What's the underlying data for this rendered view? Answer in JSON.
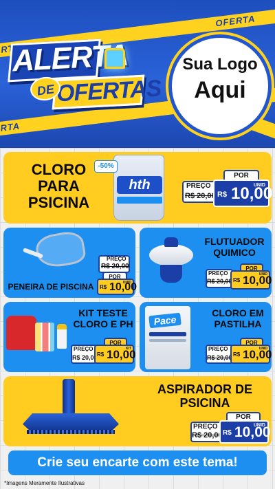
{
  "header": {
    "alerta": "ALERTA",
    "de": "DE",
    "ofertas": "OFERTAS",
    "stripe_text": "OFERTA",
    "stripe_text_2": "ALERTA",
    "logo_line1": "Sua Logo",
    "logo_line2": "Aqui"
  },
  "products": [
    {
      "title": "CLORO PARA PSICINA",
      "discount": "-50%",
      "brand": "hth",
      "preco_label": "PREÇO",
      "old_price": "R$ 20,00",
      "por_label": "POR",
      "currency": "R$",
      "price": "10,00",
      "unit": "UNID"
    },
    {
      "title": "PENEIRA DE PISCINA",
      "preco_label": "PREÇO",
      "old_price": "R$ 20,00",
      "por_label": "POR",
      "currency": "R$",
      "price": "10,00",
      "unit": "UNID"
    },
    {
      "title": "FLUTUADOR QUIMICO",
      "preco_label": "PREÇO",
      "old_price": "R$ 20,00",
      "por_label": "POR",
      "currency": "R$",
      "price": "10,00",
      "unit": "UNID"
    },
    {
      "title": "KIT TESTE CLORO E PH",
      "preco_label": "PREÇO",
      "old_price": "R$ 20,00",
      "por_label": "POR",
      "currency": "R$",
      "price": "10,00",
      "unit": "KIT"
    },
    {
      "title": "CLORO EM PASTILHA",
      "brand": "Pace",
      "preco_label": "PREÇO",
      "old_price": "R$ 20,00",
      "por_label": "POR",
      "currency": "R$",
      "price": "10,00",
      "unit": "UNID"
    },
    {
      "title": "ASPIRADOR DE PSICINA",
      "preco_label": "PREÇO",
      "old_price": "R$ 20,00",
      "por_label": "POR",
      "currency": "R$",
      "price": "10,00",
      "unit": "UNID"
    }
  ],
  "cta": "Crie seu encarte com este tema!",
  "footnote": "*Imagens Meramente Ilustrativas",
  "colors": {
    "yellow": "#ffcc1f",
    "blue": "#1d8ff0",
    "navy": "#1b3fa6"
  }
}
